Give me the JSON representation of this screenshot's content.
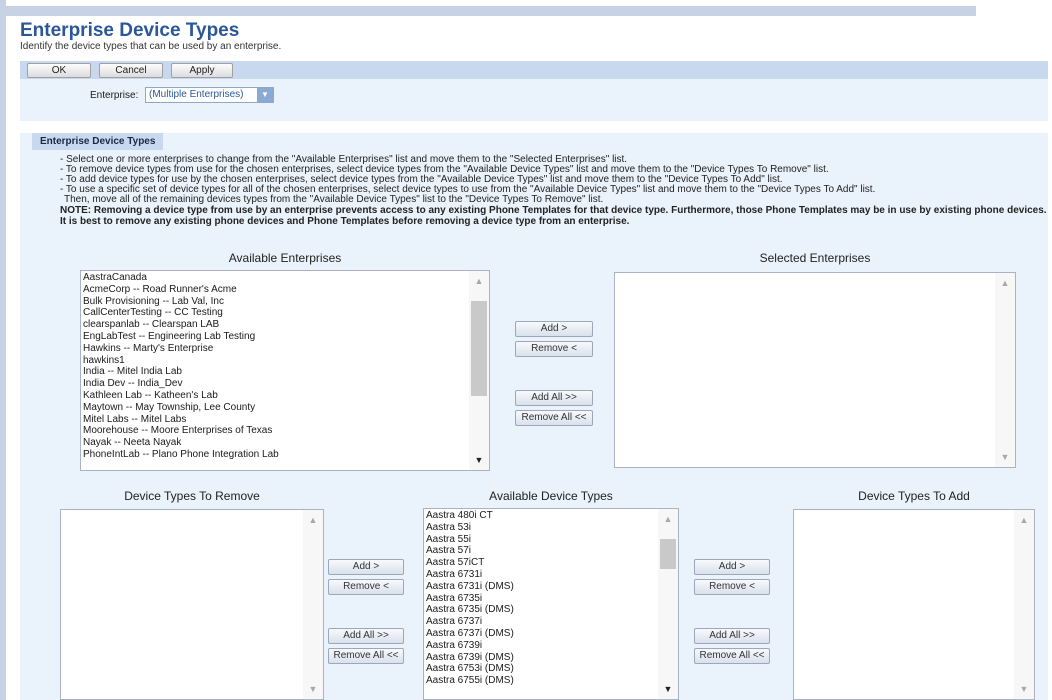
{
  "header": {
    "title": "Enterprise Device Types",
    "subtitle": "Identify the device types that can be used by an enterprise."
  },
  "toolbar": {
    "ok_label": "OK",
    "cancel_label": "Cancel",
    "apply_label": "Apply"
  },
  "enterprise_select": {
    "label": "Enterprise:",
    "value": "(Multiple Enterprises)"
  },
  "section": {
    "title": "Enterprise Device Types",
    "instructions": [
      "- Select one or more enterprises to change from the \"Available Enterprises\" list and move them to the \"Selected Enterprises\" list.",
      "- To remove device types from use for the chosen enterprises, select device types from the \"Available Device Types\" list and move them to the \"Device Types To Remove\" list.",
      "- To add device types for use by the chosen enterprises, select device types from the \"Available Device Types\" list and move them to the \"Device Types To Add\" list.",
      "- To use a specific set of device types for all of the chosen enterprises, select device types to use from the \"Available Device Types\" list and move them to the \"Device Types To Add\" list.",
      "  Then, move all of the remaining devices types from the \"Available Device Types\" list to the \"Device Types To Remove\" list."
    ],
    "note_lines": [
      "NOTE: Removing a device type from use by an enterprise prevents access to any existing Phone Templates for that device type. Furthermore, those Phone Templates may be in use by existing phone devices.",
      "It is best to remove any existing phone devices and Phone Templates before removing a device type from an enterprise."
    ]
  },
  "available_enterprises": {
    "label": "Available Enterprises",
    "items": [
      "AastraCanada",
      "AcmeCorp -- Road Runner's Acme",
      "Bulk Provisioning -- Lab Val, Inc",
      "CallCenterTesting -- CC Testing",
      "clearspanlab -- Clearspan LAB",
      "EngLabTest -- Engineering Lab Testing",
      "Hawkins -- Marty's Enterprise",
      "hawkins1",
      "India -- Mitel India Lab",
      "India Dev -- India_Dev",
      "Kathleen Lab -- Katheen's Lab",
      "Maytown -- May Township, Lee County",
      "Mitel Labs -- Mitel Labs",
      "Moorehouse -- Moore Enterprises of Texas",
      "Nayak -- Neeta Nayak",
      "PhoneIntLab -- Plano Phone Integration Lab"
    ]
  },
  "selected_enterprises": {
    "label": "Selected Enterprises",
    "items": []
  },
  "enterprise_buttons": {
    "add": "Add >",
    "remove": "Remove <",
    "add_all": "Add All >>",
    "remove_all": "Remove All <<"
  },
  "device_types_to_remove": {
    "label": "Device Types To Remove",
    "items": []
  },
  "available_device_types": {
    "label": "Available Device Types",
    "items": [
      "Aastra 480i CT",
      "Aastra 53i",
      "Aastra 55i",
      "Aastra 57i",
      "Aastra 57iCT",
      "Aastra 6731i",
      "Aastra 6731i (DMS)",
      "Aastra 6735i",
      "Aastra 6735i (DMS)",
      "Aastra 6737i",
      "Aastra 6737i (DMS)",
      "Aastra 6739i",
      "Aastra 6739i (DMS)",
      "Aastra 6753i (DMS)",
      "Aastra 6755i (DMS)"
    ]
  },
  "device_types_to_add": {
    "label": "Device Types To Add",
    "items": []
  },
  "remove_buttons": {
    "add": "Add >",
    "remove": "Remove <",
    "add_all": "Add All >>",
    "remove_all": "Remove All <<"
  },
  "add_buttons": {
    "add": "Add >",
    "remove": "Remove <",
    "add_all": "Add All >>",
    "remove_all": "Remove All <<"
  },
  "icons": {
    "scroll_up": "scroll-up-arrow-icon",
    "scroll_down": "scroll-down-arrow-icon",
    "dropdown": "chevron-down-icon"
  },
  "colors": {
    "title": "#2b5797",
    "band": "#c7d8ef",
    "panel": "#eaf2fb"
  }
}
